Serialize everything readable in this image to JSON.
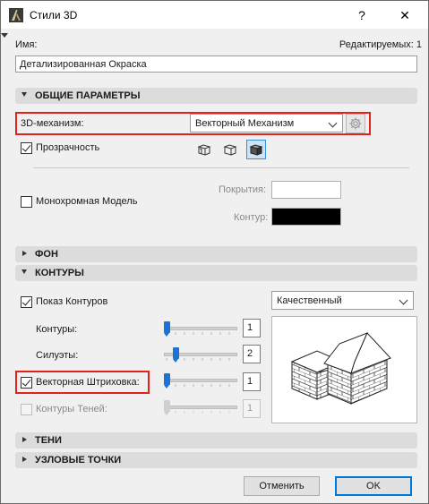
{
  "window": {
    "title": "Стили 3D",
    "help": "?",
    "close": "✕"
  },
  "name_label": "Имя:",
  "editable_label": "Редактируемых: 1",
  "name_value": "Детализированная Окраска",
  "sections": {
    "general": "ОБЩИЕ ПАРАМЕТРЫ",
    "background": "ФОН",
    "contours": "КОНТУРЫ",
    "shadows": "ТЕНИ",
    "hotspots": "УЗЛОВЫЕ ТОЧКИ"
  },
  "engine": {
    "label": "3D-механизм:",
    "value": "Векторный Механизм"
  },
  "transparency": {
    "label": "Прозрачность",
    "checked": true
  },
  "monochrome": {
    "label": "Монохромная Модель",
    "checked": false,
    "surfaces_label": "Покрытия:",
    "contour_label": "Контур:",
    "surfaces_color": "#ffffff",
    "contour_color": "#000000"
  },
  "contours": {
    "show_label": "Показ Контуров",
    "show_checked": true,
    "quality_value": "Качественный",
    "contours_label": "Контуры:",
    "contours_value": "1",
    "silhouettes_label": "Силуэты:",
    "silhouettes_value": "2",
    "vector_hatching_label": "Векторная Штриховка:",
    "vector_hatching_checked": true,
    "vector_hatching_value": "1",
    "shadow_contours_label": "Контуры Теней:",
    "shadow_contours_checked": false,
    "shadow_contours_value": "1"
  },
  "buttons": {
    "cancel": "Отменить",
    "ok": "OK"
  },
  "colors": {
    "accent": "#0078d7",
    "highlight": "#e2231a",
    "slider": "#1a73d9"
  }
}
